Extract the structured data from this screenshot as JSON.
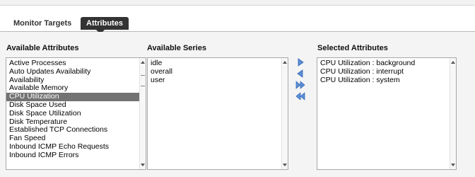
{
  "tabs": [
    {
      "label": "Monitor Targets",
      "active": false
    },
    {
      "label": "Attributes",
      "active": true
    }
  ],
  "available_attributes": {
    "heading": "Available Attributes",
    "selected": "CPU Utilization",
    "items": [
      "Active Processes",
      "Auto Updates Availability",
      "Availability",
      "Available Memory",
      "CPU Utilization",
      "Disk Space Used",
      "Disk Space Utilization",
      "Disk Temperature",
      "Established TCP Connections",
      "Fan Speed",
      "Inbound ICMP Echo Requests",
      "Inbound ICMP Errors"
    ]
  },
  "available_series": {
    "heading": "Available Series",
    "items": [
      "idle",
      "overall",
      "user"
    ]
  },
  "selected_attributes": {
    "heading": "Selected Attributes",
    "items": [
      "CPU Utilization : background",
      "CPU Utilization : interrupt",
      "CPU Utilization : system"
    ]
  },
  "move_buttons": [
    {
      "icon": "arrow-right-icon",
      "action": "add"
    },
    {
      "icon": "arrow-left-icon",
      "action": "remove"
    },
    {
      "icon": "double-arrow-right-icon",
      "action": "add-all"
    },
    {
      "icon": "double-arrow-left-icon",
      "action": "remove-all"
    }
  ],
  "colors": {
    "selection": "#737373",
    "active_tab": "#333333",
    "arrow": "#5b8fd8"
  }
}
